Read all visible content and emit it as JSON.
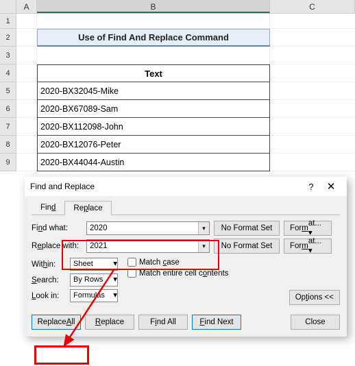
{
  "columns": {
    "a": "A",
    "b": "B",
    "c": "C"
  },
  "rows": [
    "1",
    "2",
    "3",
    "4",
    "5",
    "6",
    "7",
    "8",
    "9"
  ],
  "sheet": {
    "title": "Use of Find And Replace Command",
    "header": "Text",
    "data": [
      "2020-BX32045-Mike",
      "2020-BX67089-Sam",
      "2020-BX112098-John",
      "2020-BX12076-Peter",
      "2020-BX44044-Austin"
    ]
  },
  "dialog": {
    "title": "Find and Replace",
    "tabs": {
      "find": "Find",
      "replace": "Replace",
      "find_u": "d",
      "replace_u": "P"
    },
    "find_label": "Find what:",
    "find_value": "2020",
    "replace_label": "Replace with:",
    "replace_value": "2021",
    "no_format": "No Format Set",
    "format": "Format...",
    "within_label": "Within:",
    "within_value": "Sheet",
    "search_label": "Search:",
    "search_value": "By Rows",
    "lookin_label": "Look in:",
    "lookin_value": "Formulas",
    "match_case": "Match case",
    "match_contents": "Match entire cell contents",
    "options": "Options <<",
    "buttons": {
      "replace_all": "Replace All",
      "replace": "Replace",
      "find_all": "Find All",
      "find_next": "Find Next",
      "close": "Close"
    }
  }
}
